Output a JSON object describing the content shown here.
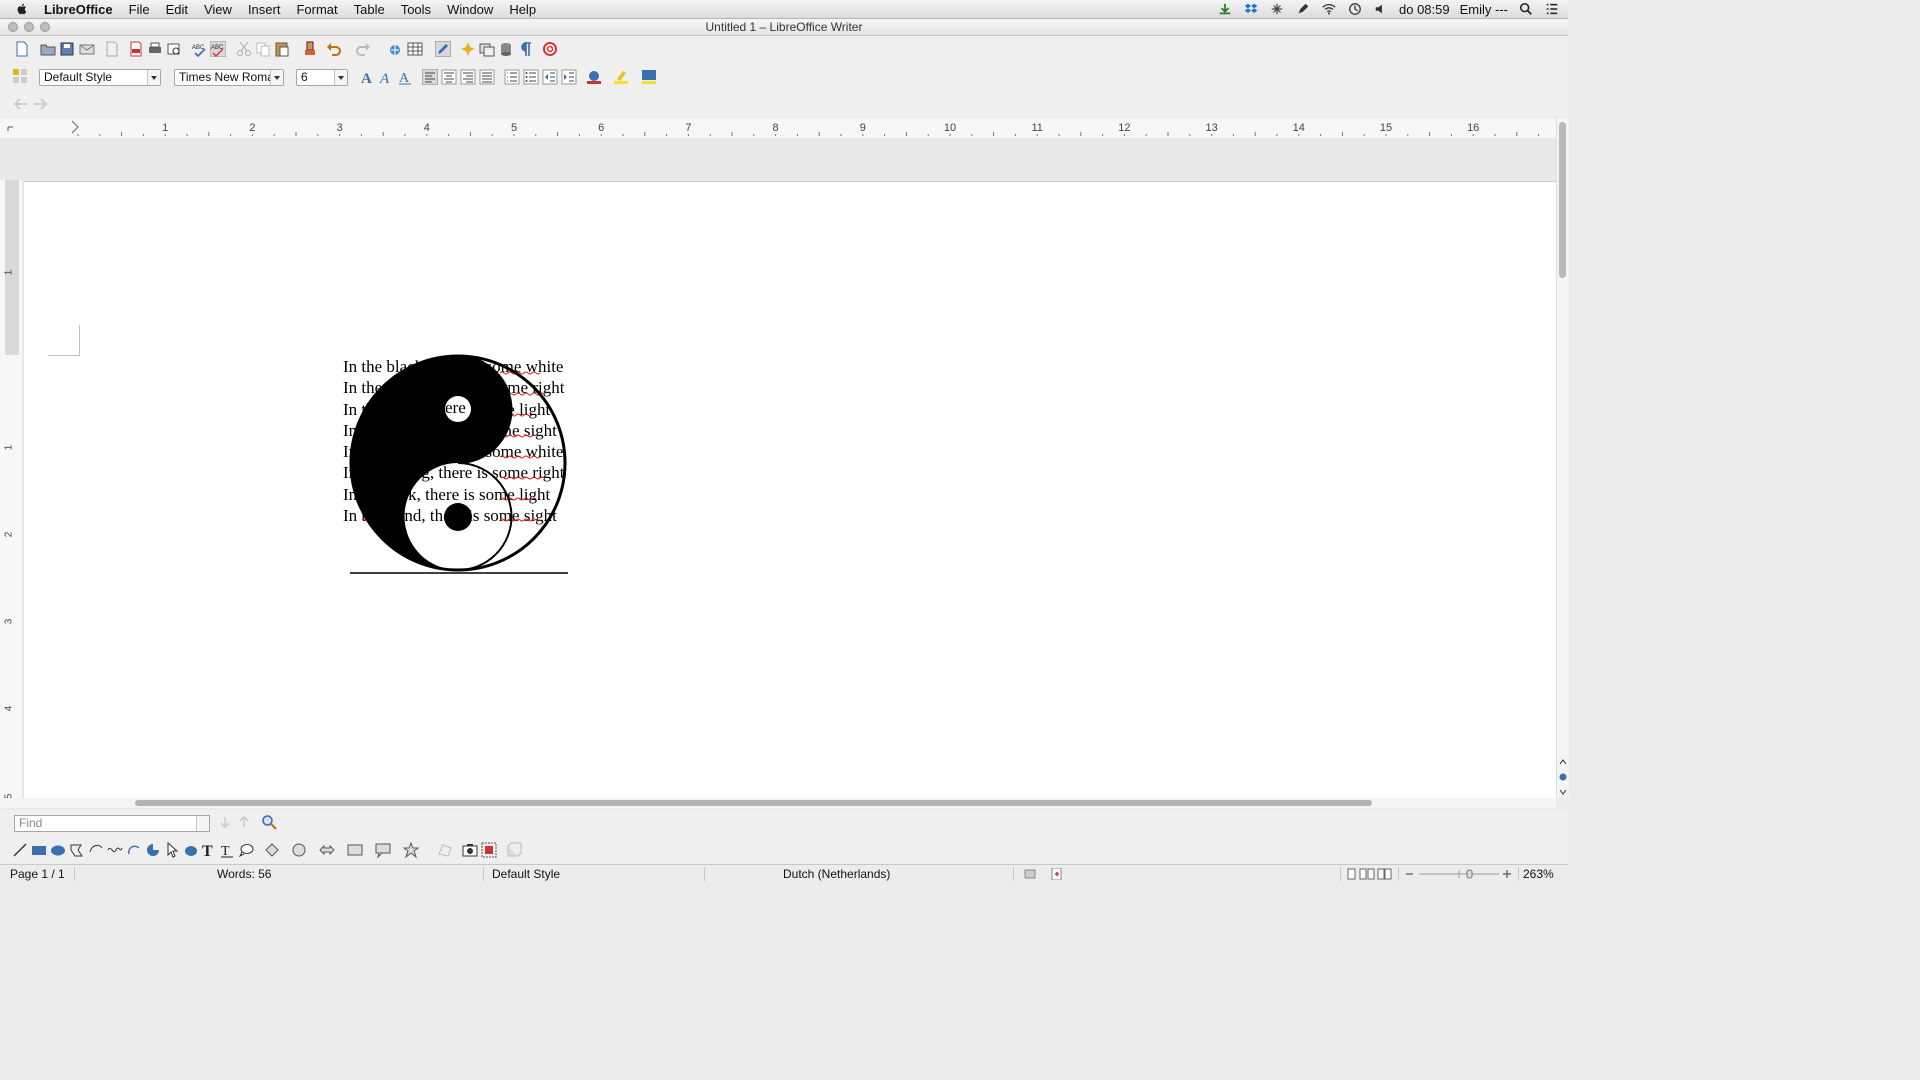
{
  "menubar": {
    "app_name": "LibreOffice",
    "items": [
      "File",
      "Edit",
      "View",
      "Insert",
      "Format",
      "Table",
      "Tools",
      "Window",
      "Help"
    ],
    "clock": "do 08:59",
    "user": "Emily ---"
  },
  "window": {
    "title": "Untitled 1 – LibreOffice Writer"
  },
  "formatting": {
    "paragraph_style": "Default Style",
    "font_name": "Times New Roman",
    "font_size": "6"
  },
  "ruler": {
    "horizontal_ticks": [
      "1",
      "2",
      "3",
      "4",
      "5",
      "6",
      "7",
      "8",
      "9",
      "10",
      "11",
      "12",
      "13",
      "14",
      "15",
      "16"
    ],
    "vertical_ticks": [
      "1",
      "1",
      "2",
      "3",
      "4",
      "5"
    ]
  },
  "document": {
    "poem_lines": [
      "In the black, there is some white",
      "In the wrong, there is some right",
      "In the dark, there is some light",
      "In the blind, there is some sight",
      "In the black, there is some white",
      "In the wrong, there is some right",
      "In the dark, there is some light",
      "In the blind, there is some sight"
    ]
  },
  "findbar": {
    "placeholder": "Find"
  },
  "status": {
    "page": "Page 1 / 1",
    "words": "Words: 56",
    "style": "Default Style",
    "language": "Dutch (Netherlands)",
    "zoom": "263%"
  },
  "colors": {
    "spellcheck": "#e02020",
    "menubar_bg": "#e6e6e6",
    "page_bg": "#ffffff"
  }
}
